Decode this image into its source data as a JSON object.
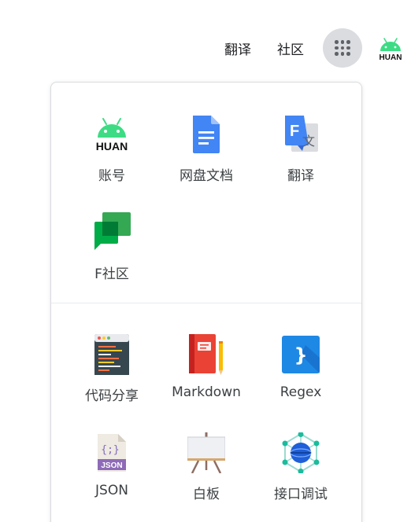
{
  "topbar": {
    "translate_link": "翻译",
    "community_link": "社区",
    "apps_button_icon": "apps-grid-icon",
    "avatar_icon": "android-logo-icon",
    "avatar_text": "HUAN"
  },
  "apps_panel": {
    "section1": [
      {
        "label": "账号",
        "icon": "android-logo-icon",
        "icon_text": "HUAN"
      },
      {
        "label": "网盘文档",
        "icon": "docs-icon"
      },
      {
        "label": "翻译",
        "icon": "translate-icon",
        "icon_text": "文"
      },
      {
        "label": "F社区",
        "icon": "chat-bubbles-icon"
      }
    ],
    "section2": [
      {
        "label": "代码分享",
        "icon": "code-editor-icon"
      },
      {
        "label": "Markdown",
        "icon": "notebook-pencil-icon"
      },
      {
        "label": "Regex",
        "icon": "regex-brace-icon",
        "icon_text": "}"
      },
      {
        "label": "JSON",
        "icon": "json-file-icon",
        "icon_text": "{;}",
        "badge_text": "JSON"
      },
      {
        "label": "白板",
        "icon": "whiteboard-easel-icon"
      },
      {
        "label": "接口调试",
        "icon": "api-network-icon"
      }
    ]
  },
  "colors": {
    "android_green": "#3ddc84",
    "docs_blue": "#4285f4",
    "chat_green": "#00ac47",
    "notebook_red": "#ea4335",
    "regex_blue": "#1e88e5",
    "json_purple": "#8e6bb8",
    "api_teal": "#1abc9c"
  }
}
